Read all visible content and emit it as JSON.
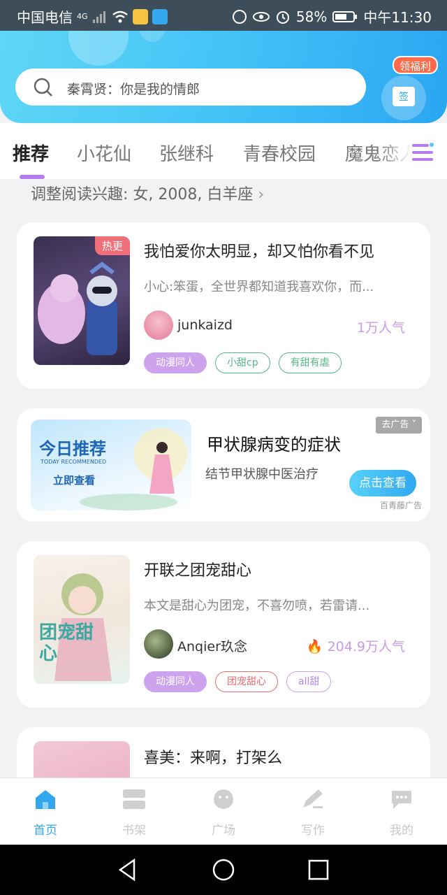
{
  "status_bar": {
    "carrier": "中国电信",
    "network": "4G",
    "battery": "58%",
    "time": "中午11:30"
  },
  "search": {
    "placeholder": "秦霄贤：你是我的情郎",
    "gift_badge": "领福利",
    "gift_box_label": "签"
  },
  "tabs": [
    {
      "label": "推荐",
      "active": true
    },
    {
      "label": "小花仙",
      "active": false
    },
    {
      "label": "张继科",
      "active": false
    },
    {
      "label": "青春校园",
      "active": false
    },
    {
      "label": "魔鬼恋人",
      "active": false
    }
  ],
  "interest_line": "调整阅读兴趣: 女, 2008, 白羊座",
  "books": [
    {
      "badge": "热更",
      "title": "我怕爱你太明显，却又怕你看不见",
      "desc": "小心:笨蛋，全世界都知道我喜欢你，而...",
      "author": "junkaizd",
      "popularity": "1万人气",
      "tags": [
        "动漫同人",
        "小甜cp",
        "有甜有虐"
      ]
    },
    {
      "title": "开联之团宠甜心",
      "desc": "本文是甜心为团宠，不喜勿喷，若雷请...",
      "author": "Anqier玖念",
      "popularity": "204.9万人气",
      "tags": [
        "动漫同人",
        "团宠甜心",
        "all甜"
      ],
      "cover_text": "团宠甜心"
    },
    {
      "title": "喜美：来啊，打架么"
    }
  ],
  "ad": {
    "banner_title": "今日推荐",
    "banner_subtitle": "TODAY RECOMMENDED",
    "banner_cta": "立即查看",
    "close_label": "去广告",
    "title": "甲状腺病变的症状",
    "subtitle": "结节甲状腺中医治疗",
    "button": "点击查看",
    "source": "百青藤广告"
  },
  "bottom_nav": [
    {
      "label": "首页",
      "icon": "home-icon",
      "active": true
    },
    {
      "label": "书架",
      "icon": "bookshelf-icon",
      "active": false
    },
    {
      "label": "广场",
      "icon": "plaza-icon",
      "active": false
    },
    {
      "label": "写作",
      "icon": "write-icon",
      "active": false
    },
    {
      "label": "我的",
      "icon": "chat-icon",
      "active": false
    }
  ],
  "colors": {
    "accent": "#32a7f0",
    "tab_indicator": "#b57cf0",
    "header_gradient_start": "#5fd6f5",
    "header_gradient_end": "#2aa6f2"
  }
}
